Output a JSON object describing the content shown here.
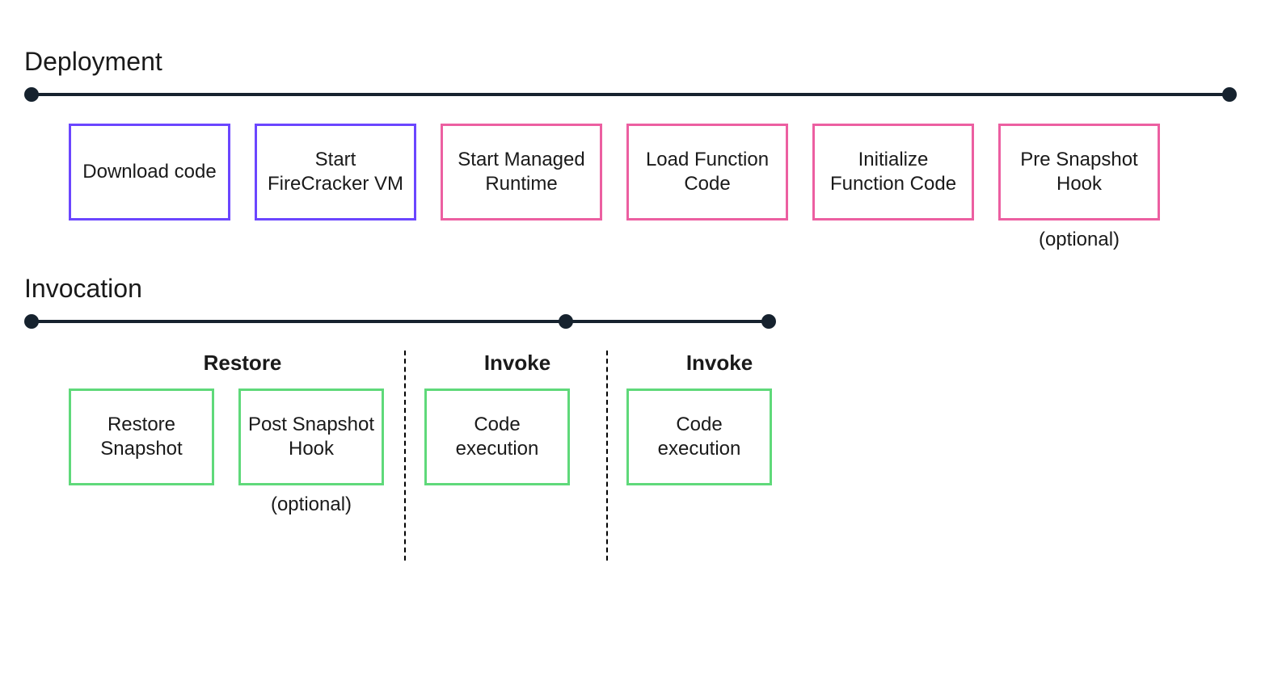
{
  "deployment": {
    "title": "Deployment",
    "steps": [
      {
        "label": "Download code",
        "color": "purple"
      },
      {
        "label": "Start FireCracker VM",
        "color": "purple"
      },
      {
        "label": "Start Managed Runtime",
        "color": "pink"
      },
      {
        "label": "Load Function Code",
        "color": "pink"
      },
      {
        "label": "Initialize Function Code",
        "color": "pink"
      },
      {
        "label": "Pre Snapshot Hook",
        "color": "pink",
        "caption": "(optional)"
      }
    ]
  },
  "invocation": {
    "title": "Invocation",
    "phases": [
      {
        "label": "Restore",
        "boxes": [
          {
            "label": "Restore Snapshot",
            "color": "green"
          },
          {
            "label": "Post Snapshot Hook",
            "color": "green",
            "caption": "(optional)"
          }
        ]
      },
      {
        "label": "Invoke",
        "boxes": [
          {
            "label": "Code execution",
            "color": "green"
          }
        ]
      },
      {
        "label": "Invoke",
        "boxes": [
          {
            "label": "Code execution",
            "color": "green"
          }
        ]
      }
    ]
  }
}
